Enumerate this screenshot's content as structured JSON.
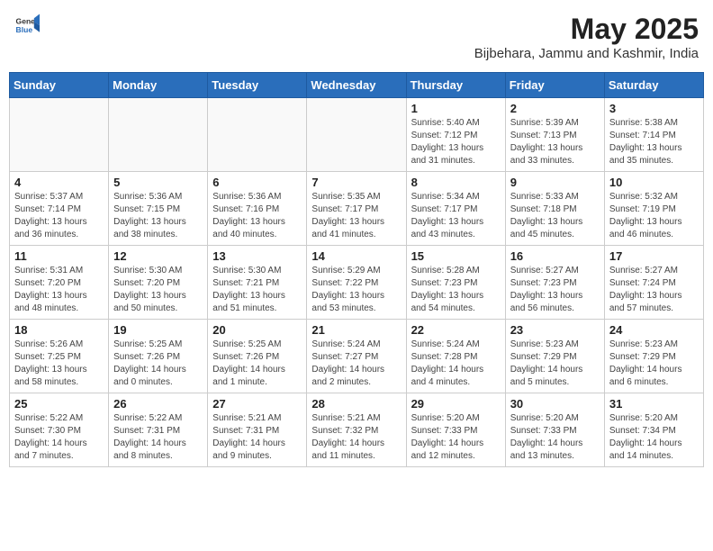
{
  "header": {
    "logo_general": "General",
    "logo_blue": "Blue",
    "title": "May 2025",
    "subtitle": "Bijbehara, Jammu and Kashmir, India"
  },
  "weekdays": [
    "Sunday",
    "Monday",
    "Tuesday",
    "Wednesday",
    "Thursday",
    "Friday",
    "Saturday"
  ],
  "weeks": [
    [
      {
        "day": "",
        "info": ""
      },
      {
        "day": "",
        "info": ""
      },
      {
        "day": "",
        "info": ""
      },
      {
        "day": "",
        "info": ""
      },
      {
        "day": "1",
        "info": "Sunrise: 5:40 AM\nSunset: 7:12 PM\nDaylight: 13 hours\nand 31 minutes."
      },
      {
        "day": "2",
        "info": "Sunrise: 5:39 AM\nSunset: 7:13 PM\nDaylight: 13 hours\nand 33 minutes."
      },
      {
        "day": "3",
        "info": "Sunrise: 5:38 AM\nSunset: 7:14 PM\nDaylight: 13 hours\nand 35 minutes."
      }
    ],
    [
      {
        "day": "4",
        "info": "Sunrise: 5:37 AM\nSunset: 7:14 PM\nDaylight: 13 hours\nand 36 minutes."
      },
      {
        "day": "5",
        "info": "Sunrise: 5:36 AM\nSunset: 7:15 PM\nDaylight: 13 hours\nand 38 minutes."
      },
      {
        "day": "6",
        "info": "Sunrise: 5:36 AM\nSunset: 7:16 PM\nDaylight: 13 hours\nand 40 minutes."
      },
      {
        "day": "7",
        "info": "Sunrise: 5:35 AM\nSunset: 7:17 PM\nDaylight: 13 hours\nand 41 minutes."
      },
      {
        "day": "8",
        "info": "Sunrise: 5:34 AM\nSunset: 7:17 PM\nDaylight: 13 hours\nand 43 minutes."
      },
      {
        "day": "9",
        "info": "Sunrise: 5:33 AM\nSunset: 7:18 PM\nDaylight: 13 hours\nand 45 minutes."
      },
      {
        "day": "10",
        "info": "Sunrise: 5:32 AM\nSunset: 7:19 PM\nDaylight: 13 hours\nand 46 minutes."
      }
    ],
    [
      {
        "day": "11",
        "info": "Sunrise: 5:31 AM\nSunset: 7:20 PM\nDaylight: 13 hours\nand 48 minutes."
      },
      {
        "day": "12",
        "info": "Sunrise: 5:30 AM\nSunset: 7:20 PM\nDaylight: 13 hours\nand 50 minutes."
      },
      {
        "day": "13",
        "info": "Sunrise: 5:30 AM\nSunset: 7:21 PM\nDaylight: 13 hours\nand 51 minutes."
      },
      {
        "day": "14",
        "info": "Sunrise: 5:29 AM\nSunset: 7:22 PM\nDaylight: 13 hours\nand 53 minutes."
      },
      {
        "day": "15",
        "info": "Sunrise: 5:28 AM\nSunset: 7:23 PM\nDaylight: 13 hours\nand 54 minutes."
      },
      {
        "day": "16",
        "info": "Sunrise: 5:27 AM\nSunset: 7:23 PM\nDaylight: 13 hours\nand 56 minutes."
      },
      {
        "day": "17",
        "info": "Sunrise: 5:27 AM\nSunset: 7:24 PM\nDaylight: 13 hours\nand 57 minutes."
      }
    ],
    [
      {
        "day": "18",
        "info": "Sunrise: 5:26 AM\nSunset: 7:25 PM\nDaylight: 13 hours\nand 58 minutes."
      },
      {
        "day": "19",
        "info": "Sunrise: 5:25 AM\nSunset: 7:26 PM\nDaylight: 14 hours\nand 0 minutes."
      },
      {
        "day": "20",
        "info": "Sunrise: 5:25 AM\nSunset: 7:26 PM\nDaylight: 14 hours\nand 1 minute."
      },
      {
        "day": "21",
        "info": "Sunrise: 5:24 AM\nSunset: 7:27 PM\nDaylight: 14 hours\nand 2 minutes."
      },
      {
        "day": "22",
        "info": "Sunrise: 5:24 AM\nSunset: 7:28 PM\nDaylight: 14 hours\nand 4 minutes."
      },
      {
        "day": "23",
        "info": "Sunrise: 5:23 AM\nSunset: 7:29 PM\nDaylight: 14 hours\nand 5 minutes."
      },
      {
        "day": "24",
        "info": "Sunrise: 5:23 AM\nSunset: 7:29 PM\nDaylight: 14 hours\nand 6 minutes."
      }
    ],
    [
      {
        "day": "25",
        "info": "Sunrise: 5:22 AM\nSunset: 7:30 PM\nDaylight: 14 hours\nand 7 minutes."
      },
      {
        "day": "26",
        "info": "Sunrise: 5:22 AM\nSunset: 7:31 PM\nDaylight: 14 hours\nand 8 minutes."
      },
      {
        "day": "27",
        "info": "Sunrise: 5:21 AM\nSunset: 7:31 PM\nDaylight: 14 hours\nand 9 minutes."
      },
      {
        "day": "28",
        "info": "Sunrise: 5:21 AM\nSunset: 7:32 PM\nDaylight: 14 hours\nand 11 minutes."
      },
      {
        "day": "29",
        "info": "Sunrise: 5:20 AM\nSunset: 7:33 PM\nDaylight: 14 hours\nand 12 minutes."
      },
      {
        "day": "30",
        "info": "Sunrise: 5:20 AM\nSunset: 7:33 PM\nDaylight: 14 hours\nand 13 minutes."
      },
      {
        "day": "31",
        "info": "Sunrise: 5:20 AM\nSunset: 7:34 PM\nDaylight: 14 hours\nand 14 minutes."
      }
    ]
  ]
}
